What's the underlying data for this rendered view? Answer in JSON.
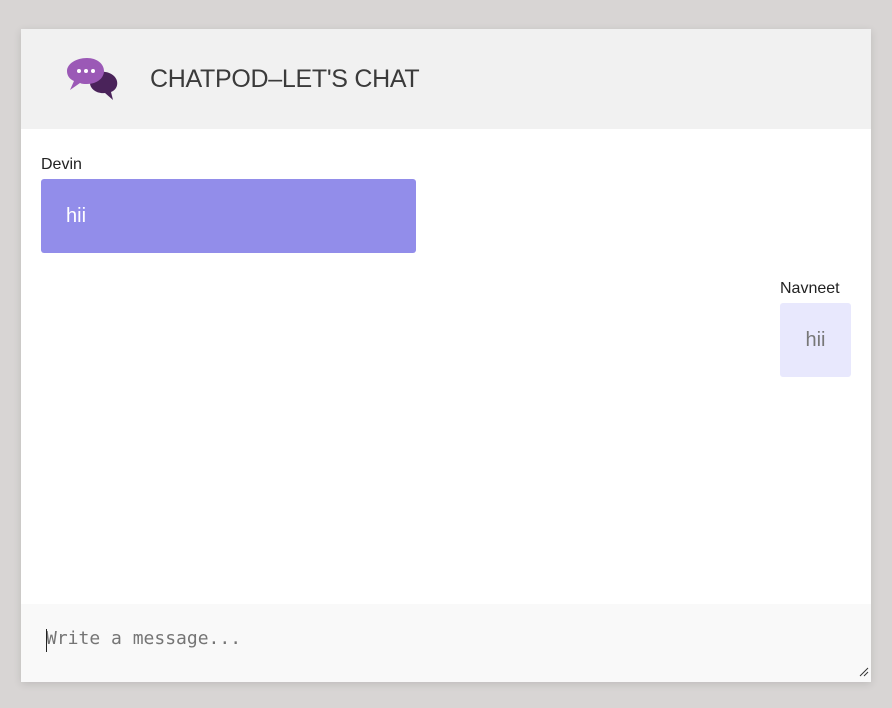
{
  "header": {
    "logo_icon": "chat-bubbles-icon",
    "title": "CHATPOD–LET'S CHAT"
  },
  "messages": [
    {
      "sender": "Devin",
      "text": "hii",
      "side": "left"
    },
    {
      "sender": "Navneet",
      "text": "hii",
      "side": "right"
    }
  ],
  "composer": {
    "placeholder": "Write a message...",
    "value": ""
  },
  "colors": {
    "sent_bubble": "#928dea",
    "received_bubble": "#e8e8fd",
    "logo_purple": "#9b59b6",
    "logo_dark": "#4a235a",
    "header_bg": "#f1f1f1"
  }
}
